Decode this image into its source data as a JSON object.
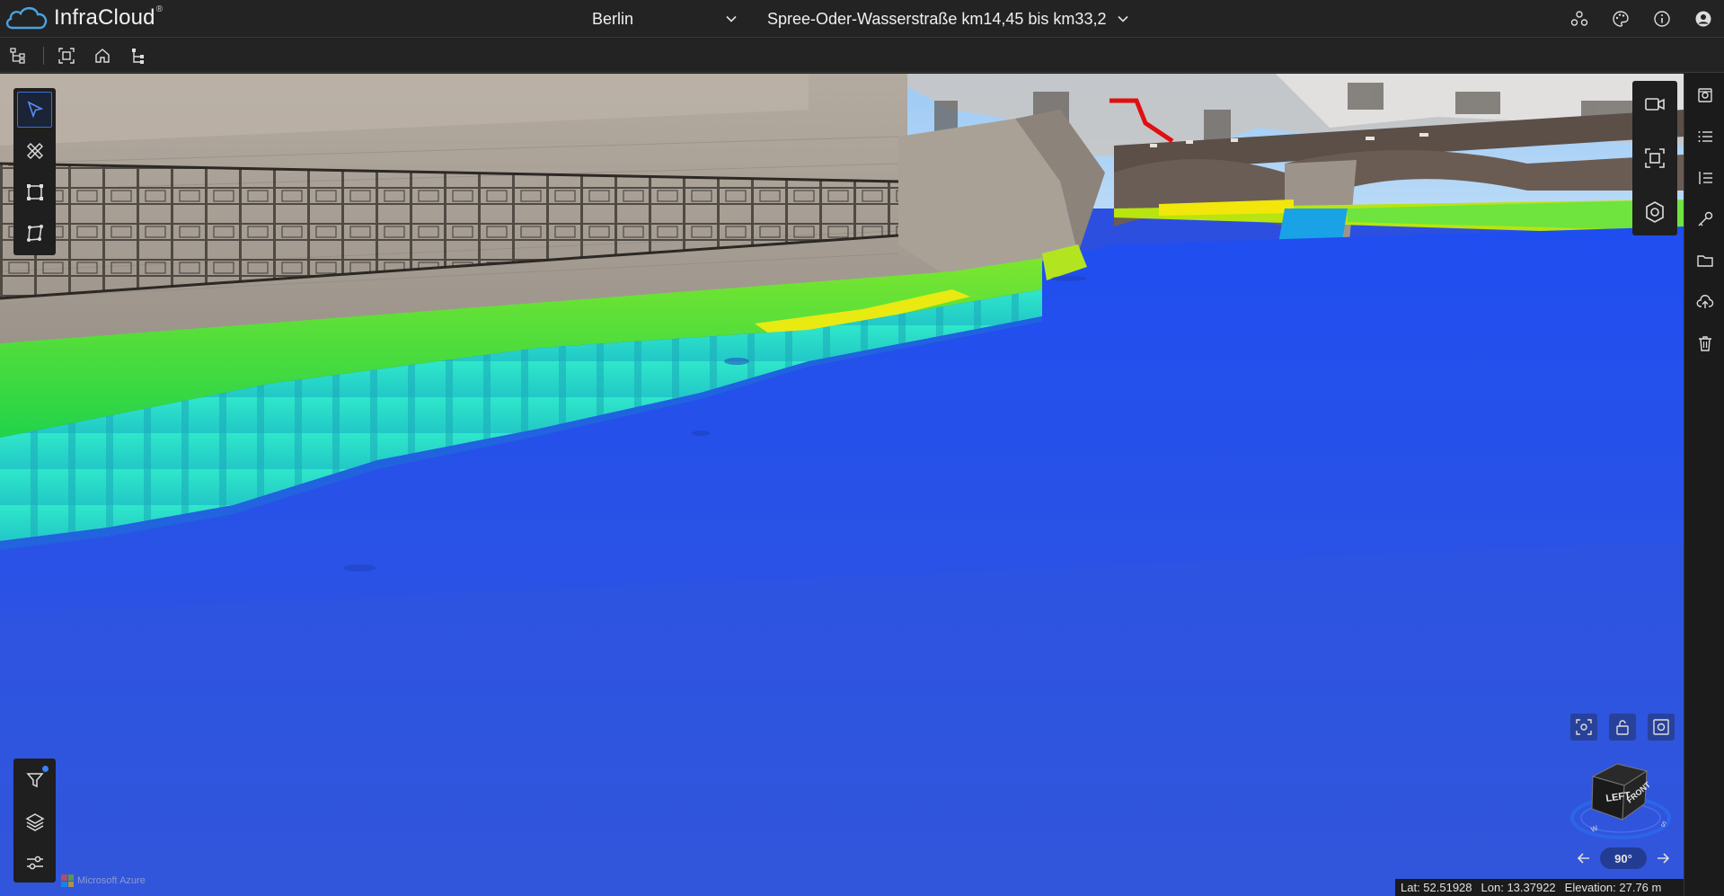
{
  "app": {
    "brand": "InfraCloud",
    "brand_reg": "®"
  },
  "header": {
    "city_selector": {
      "value": "Berlin"
    },
    "project_selector": {
      "value": "Spree-Oder-Wasserstraße km14,45 bis km33,2"
    },
    "right_icons": [
      "collaboration-icon",
      "palette-icon",
      "info-icon",
      "account-icon"
    ]
  },
  "toolbar": {
    "items": [
      "tree-structure-icon",
      "fit-view-icon",
      "home-icon",
      "hierarchy-icon"
    ]
  },
  "left_tools": {
    "items": [
      "select-icon",
      "measure-tools-icon",
      "area-icon",
      "polygon-icon"
    ],
    "active": "select-icon"
  },
  "left_bottom_tools": {
    "items": [
      "filter-icon",
      "layers-icon",
      "settings-sliders-icon"
    ]
  },
  "camera_tools": {
    "items": [
      "video-camera-icon",
      "focus-frame-icon",
      "pointcloud-icon"
    ]
  },
  "right_sidebar": {
    "items": [
      "properties-icon",
      "list-icon",
      "ordered-list-icon",
      "key-icon",
      "folder-icon",
      "upload-cloud-icon",
      "trash-icon"
    ]
  },
  "navigation": {
    "cube_faces": {
      "left": "LEFT",
      "front": "FRONT"
    },
    "rotation_step": "90°",
    "mini_buttons": [
      "focus-target-icon",
      "lock-open-icon",
      "snapshot-icon"
    ]
  },
  "status_bar": {
    "lat": "Lat: 52.51928",
    "lon": "Lon: 13.37922",
    "elevation": "Elevation: 27.76 m"
  },
  "attribution": {
    "text": "Microsoft Azure"
  },
  "colors": {
    "accent": "#3b6fd6",
    "water": "#2c4fe0",
    "bar_bg": "#232323"
  }
}
